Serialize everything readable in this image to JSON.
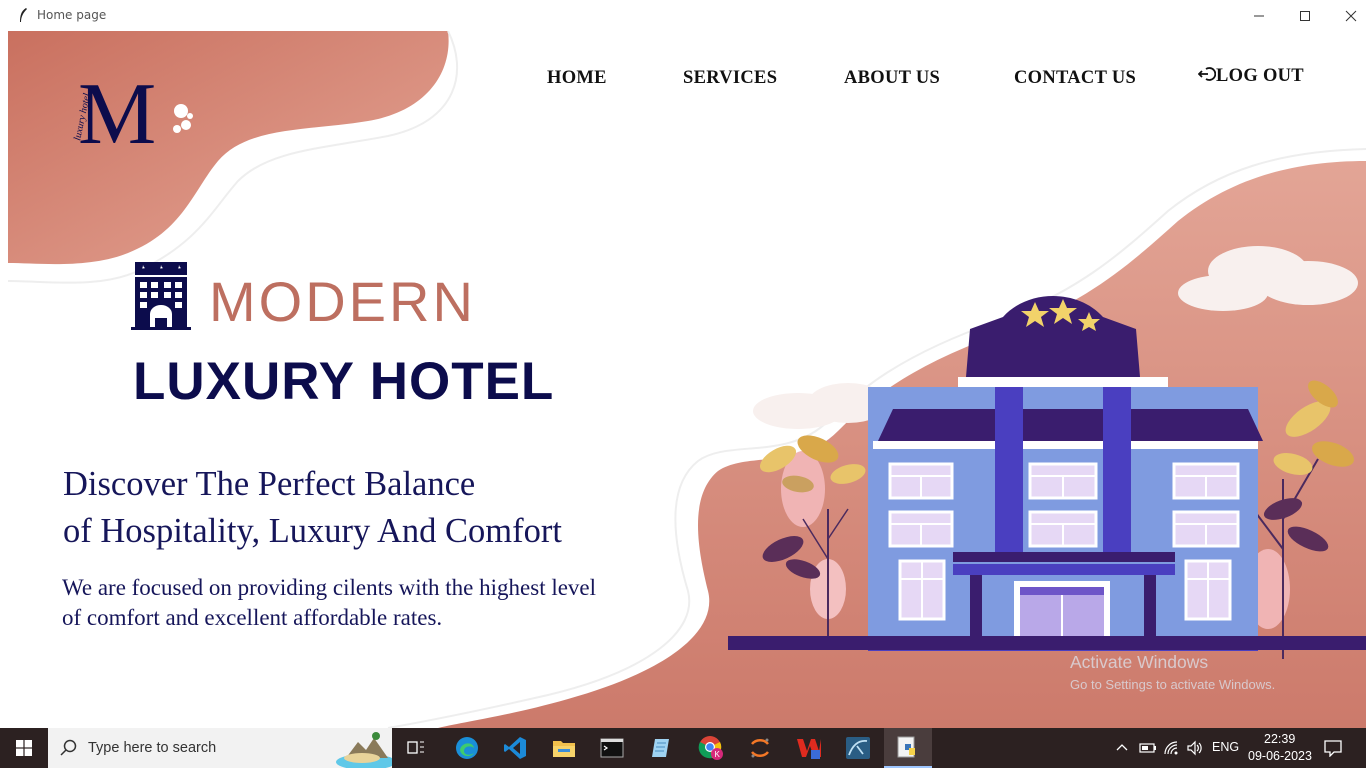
{
  "window": {
    "title": "Home page",
    "icon": "feather-icon",
    "controls": [
      "minimize-icon",
      "maximize-icon",
      "close-icon"
    ]
  },
  "logo": {
    "icon": "luxury-hotel-logo",
    "monogram": "M",
    "script_text": "luxury hotel"
  },
  "nav": {
    "home": "HOME",
    "services": "SERVICES",
    "about": "ABOUT US",
    "contact": "CONTACT US",
    "logout": "LOG OUT",
    "logout_icon": "logout-icon"
  },
  "hero": {
    "icon": "hotel-building-icon",
    "modern": "MODERN",
    "luxury": "LUXURY HOTEL",
    "tagline_line1": "Discover The Perfect Balance",
    "tagline_line2": "of Hospitality, Luxury And Comfort",
    "desc_line1": "We are focused on providing cilents with the highest level",
    "desc_line2": "of comfort and excellent affordable rates.",
    "illustration": "hotel-illustration"
  },
  "watermark": {
    "line1": "Activate Windows",
    "line2": "Go to Settings to activate Windows."
  },
  "taskbar": {
    "search_placeholder": "Type here to search",
    "apps": [
      "task-view-icon",
      "edge-icon",
      "vscode-icon",
      "file-explorer-icon",
      "terminal-icon",
      "notepad-icon",
      "chrome-icon",
      "jupyter-icon",
      "wps-icon",
      "mysql-workbench-icon",
      "python-idle-icon"
    ],
    "language": "ENG",
    "time": "22:39",
    "date": "09-06-2023"
  },
  "colors": {
    "accent_salmon": "#d9897a",
    "navy": "#0c0c4c",
    "purple": "#3a1d6e",
    "building_blue": "#7f9be0",
    "taskbar": "#2c2121"
  }
}
